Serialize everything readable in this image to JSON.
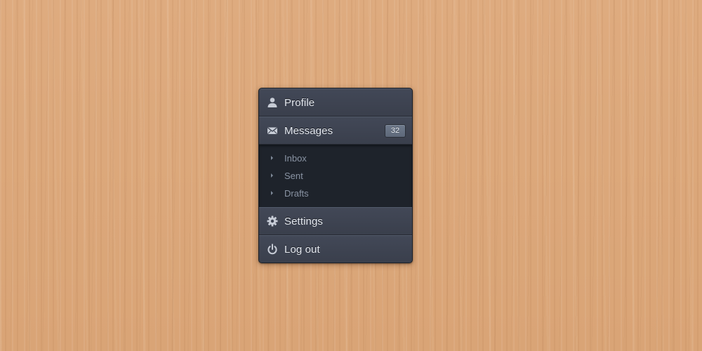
{
  "menu": {
    "items": [
      {
        "label": "Profile",
        "icon": "user-icon"
      },
      {
        "label": "Messages",
        "icon": "envelope-icon",
        "badge": "32"
      },
      {
        "label": "Settings",
        "icon": "gear-icon"
      },
      {
        "label": "Log out",
        "icon": "power-icon"
      }
    ],
    "submenu": [
      {
        "label": "Inbox"
      },
      {
        "label": "Sent"
      },
      {
        "label": "Drafts"
      }
    ]
  },
  "colors": {
    "background": "#dba77a",
    "menu_item": "#3f4553",
    "submenu_bg": "#1e232b",
    "text": "#e4e8ef",
    "subtext": "#8993a3",
    "badge": "#677284"
  }
}
